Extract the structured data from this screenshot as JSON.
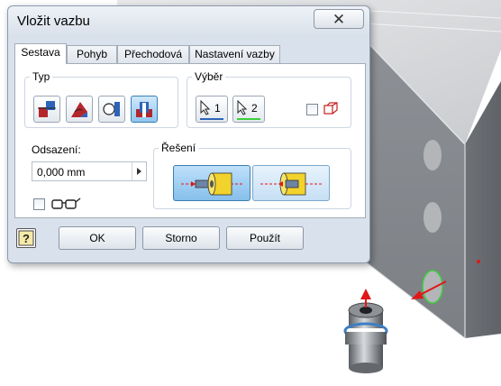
{
  "dialog": {
    "title": "Vložit vazbu",
    "close_label": "✕"
  },
  "tabs": [
    {
      "label": "Sestava",
      "active": true
    },
    {
      "label": "Pohyb",
      "active": false
    },
    {
      "label": "Přechodová",
      "active": false
    },
    {
      "label": "Nastavení vazby",
      "active": false
    }
  ],
  "type_group": {
    "label": "Typ",
    "buttons": [
      {
        "icon": "mate-constraint-icon",
        "selected": false
      },
      {
        "icon": "angle-constraint-icon",
        "selected": false
      },
      {
        "icon": "tangent-constraint-icon",
        "selected": false
      },
      {
        "icon": "insert-constraint-icon",
        "selected": true
      }
    ]
  },
  "selection_group": {
    "label": "Výběr",
    "select1_label": "1",
    "select2_label": "2",
    "first_pick_checked": false,
    "icon": "first-click-selection-icon"
  },
  "offset": {
    "label": "Odsazení:",
    "value": "0,000 mm"
  },
  "preview": {
    "checked": false,
    "icon": "glasses-icon"
  },
  "solution_group": {
    "label": "Řešení",
    "options": [
      {
        "name": "opposed",
        "selected": true
      },
      {
        "name": "aligned",
        "selected": false
      }
    ]
  },
  "footer": {
    "help_icon": "help-icon",
    "ok_label": "OK",
    "cancel_label": "Storno",
    "apply_label": "Použít"
  },
  "colors": {
    "dialog_bg": "#d9e1ec",
    "selected_blue": "#8fc6ef",
    "part_gray": "#8a8e93",
    "arrow_red": "#e01818",
    "edge_green": "#3ccf3c"
  }
}
